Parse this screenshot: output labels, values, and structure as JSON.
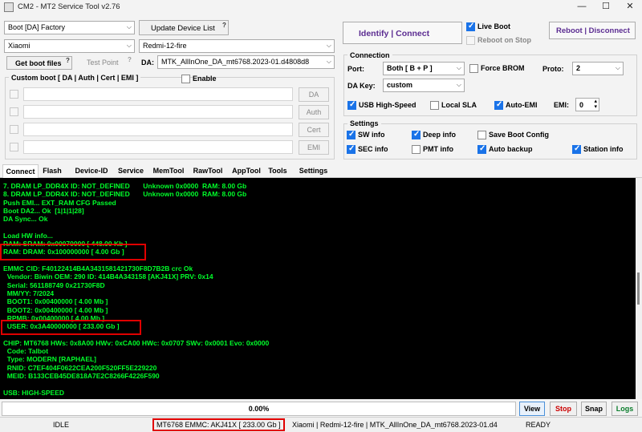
{
  "window": {
    "title": "CM2 - MT2 Service Tool v2.76",
    "min": "—",
    "max": "☐",
    "close": "✕"
  },
  "left": {
    "boot_mode": "Boot [DA] Factory",
    "update_device_list": "Update Device List",
    "brand": "Xiaomi",
    "model": "Redmi-12-fire",
    "get_boot_files": "Get boot files",
    "test_point": "Test Point",
    "da_label": "DA:",
    "da_value": "MTK_AllInOne_DA_mt6768.2023-01.d4808d8",
    "custom_boot_title": "Custom boot [ DA | Auth | Cert | EMI ]",
    "enable_label": "Enable",
    "side_buttons": [
      "DA",
      "Auth",
      "Cert",
      "EMI"
    ],
    "help": "?"
  },
  "right": {
    "identify_connect": "Identify | Connect",
    "live_boot": "Live Boot",
    "reboot_on_stop": "Reboot on Stop",
    "reboot_disconnect": "Reboot | Disconnect",
    "connection_title": "Connection",
    "port_label": "Port:",
    "port_value": "Both [ B + P ]",
    "force_brom": "Force BROM",
    "proto_label": "Proto:",
    "proto_value": "2",
    "dakey_label": "DA Key:",
    "dakey_value": "custom",
    "usb_high_speed": "USB High-Speed",
    "local_sla": "Local SLA",
    "auto_emi": "Auto-EMI",
    "emi_label": "EMI:",
    "emi_value": "0",
    "settings_title": "Settings",
    "sw_info": "SW info",
    "deep_info": "Deep info",
    "save_boot_config": "Save Boot Config",
    "sec_info": "SEC info",
    "pmt_info": "PMT info",
    "auto_backup": "Auto backup",
    "station_info": "Station info"
  },
  "tabs": [
    "Connect",
    "Flash",
    "Device-ID",
    "Service",
    "MemTool",
    "RawTool",
    "AppTool",
    "Tools",
    "Settings"
  ],
  "console": [
    "7. DRAM LP_DDR4X ID: NOT_DEFINED       Unknown 0x0000  RAM: 8.00 Gb",
    "8. DRAM LP_DDR4X ID: NOT_DEFINED       Unknown 0x0000  RAM: 8.00 Gb",
    "Push EMI... EXT_RAM CFG Passed",
    "Boot DA2... Ok  [1|1|1|28]",
    "DA Sync... Ok",
    "",
    "Load HW info...",
    "RAM: SRAM: 0x00070000 [ 448.00 Kb ]",
    "RAM: DRAM: 0x100000000 [ 4.00 Gb ]",
    "",
    "EMMC CID: F40122414B4A3431581421730F8D7B2B crc Ok",
    "  Vendor: Biwin OEM: 290 ID: 414B4A343158 [AKJ41X] PRV: 0x14",
    "  Serial: 561188749 0x21730F8D",
    "  MM/YY: 7/2024",
    "  BOOT1: 0x00400000 [ 4.00 Mb ]",
    "  BOOT2: 0x00400000 [ 4.00 Mb ]",
    "  RPMB: 0x00400000 [ 4.00 Mb ]",
    "  USER: 0x3A40000000 [ 233.00 Gb ]",
    "",
    "CHIP: MT6768 HWs: 0x8A00 HWv: 0xCA00 HWc: 0x0707 SWv: 0x0001 Evo: 0x0000",
    "  Code: Talbot",
    "  Type: MODERN [RAPHAEL]",
    "  RNID: C7EF404F0622CEA200F520FF5E229220",
    "  MEID: B133CEB45DE818A7E2C8266F4226F590",
    "",
    "USB: HIGH-SPEED"
  ],
  "progress": {
    "text": "0.00%",
    "value": 0
  },
  "bottom_buttons": {
    "view": "View",
    "stop": "Stop",
    "snap": "Snap",
    "logs": "Logs"
  },
  "status": {
    "state": "IDLE",
    "emmc": "MT6768 EMMC: AKJ41X  [ 233.00 Gb ]",
    "device": "Xiaomi | Redmi-12-fire | MTK_AllInOne_DA_mt6768.2023-01.d4",
    "ready": "READY"
  },
  "colors": {
    "console_text": "#00ff2a",
    "highlight": "#e00000",
    "link_purple": "#5b2c91",
    "stop_red": "#cc0000",
    "logs_green": "#0a7d2c"
  }
}
